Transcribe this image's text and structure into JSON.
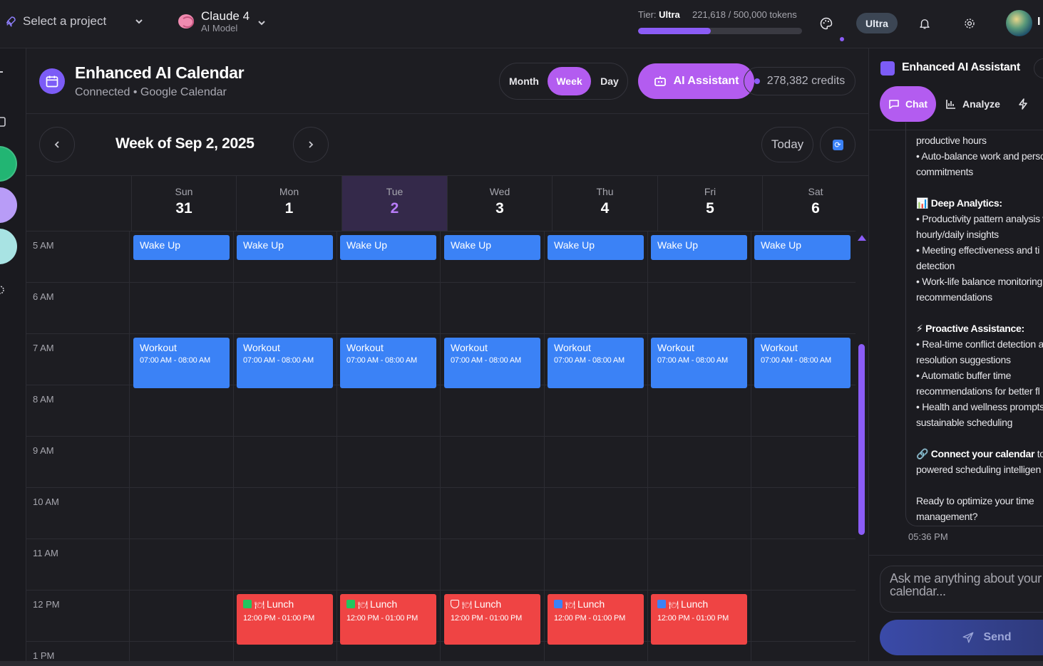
{
  "topbar": {
    "project_label": "Select a project",
    "model_name": "Claude 4",
    "model_sub": "AI Model",
    "tier_label": "Tier:",
    "tier_value": "Ultra",
    "tokens_text": "221,618 / 500,000 tokens",
    "tokens_progress": 0.443,
    "plan_badge": "Ultra",
    "user_initial": "I"
  },
  "calendar": {
    "title": "Enhanced AI Calendar",
    "subtitle": "Connected • Google Calendar",
    "views": [
      "Month",
      "Week",
      "Day"
    ],
    "active_view": "Week",
    "ai_button": "AI Assistant",
    "credits": "278,382 credits",
    "week_title": "Week of Sep 2, 2025",
    "today_button": "Today",
    "days": [
      {
        "name": "Sun",
        "date": "31"
      },
      {
        "name": "Mon",
        "date": "1"
      },
      {
        "name": "Tue",
        "date": "2",
        "today": true
      },
      {
        "name": "Wed",
        "date": "3"
      },
      {
        "name": "Thu",
        "date": "4"
      },
      {
        "name": "Fri",
        "date": "5"
      },
      {
        "name": "Sat",
        "date": "6"
      }
    ],
    "hours": [
      "5 AM",
      "6 AM",
      "7 AM",
      "8 AM",
      "9 AM",
      "10 AM",
      "11 AM",
      "12 PM",
      "1 PM"
    ],
    "events": {
      "wake": {
        "title": "Wake Up",
        "days": [
          0,
          1,
          2,
          3,
          4,
          5,
          6
        ]
      },
      "workout": {
        "title": "Workout",
        "time": "07:00 AM - 08:00 AM",
        "days": [
          0,
          1,
          2,
          3,
          4,
          5,
          6
        ]
      },
      "lunch": {
        "title": "Lunch",
        "time": "12:00 PM - 01:00 PM",
        "days": [
          1,
          2,
          3,
          4,
          5
        ],
        "badges": [
          "check",
          "check",
          "shield",
          "free",
          "free"
        ]
      }
    },
    "colors": {
      "accent": "#b35cf0",
      "event_blue": "#3b82f6",
      "event_red": "#ef4444",
      "today_bg": "#34294a"
    }
  },
  "assistant": {
    "title": "Enhanced AI Assistant",
    "tabs": [
      "Chat",
      "Analyze"
    ],
    "message": {
      "line1": "productive hours",
      "line2": "• Auto-balance work and perso",
      "line3": "commitments",
      "h1": "📊 Deep Analytics:",
      "l4": "• Productivity pattern analysis w",
      "l5": "hourly/daily insights",
      "l6": "• Meeting effectiveness and ti",
      "l7": "detection",
      "l8": "• Work-life balance monitoring",
      "l9": "recommendations",
      "h2": "⚡ Proactive Assistance:",
      "l10": "• Real-time conflict detection a",
      "l11": "resolution suggestions",
      "l12": "• Automatic buffer time",
      "l13": "recommendations for better fl",
      "l14": "• Health and wellness prompts",
      "l15": "sustainable scheduling",
      "h3a": "🔗 Connect your calendar",
      "h3b": " to u",
      "l16": "powered scheduling intelligen",
      "l17": "Ready to optimize your time",
      "l18": "management?"
    },
    "time": "05:36 PM",
    "input_placeholder": "Ask me anything about your calendar...",
    "send_label": "Send"
  }
}
